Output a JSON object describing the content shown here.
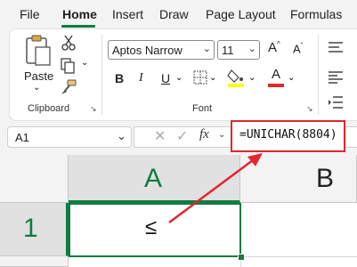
{
  "menu": {
    "tabs": [
      "File",
      "Home",
      "Insert",
      "Draw",
      "Page Layout",
      "Formulas"
    ],
    "active": "Home"
  },
  "ribbon": {
    "clipboard": {
      "paste_label": "Paste",
      "group_label": "Clipboard"
    },
    "font": {
      "font_name": "Aptos Narrow",
      "font_size": "11",
      "bold": "B",
      "italic": "I",
      "underline": "U",
      "grow": "A^",
      "shrink": "Aˇ",
      "group_label": "Font"
    },
    "colors": {
      "highlight": "#ffff00",
      "font_color": "#e1262f",
      "accent": "#107c41"
    }
  },
  "formula_bar": {
    "name_box": "A1",
    "fx": "fx",
    "formula": "=UNICHAR(8804)"
  },
  "sheet": {
    "columns": [
      "A",
      "B"
    ],
    "rows": [
      "1"
    ],
    "cells": {
      "A1": "≤"
    }
  },
  "annotation": {
    "arrow_color": "#e1262f"
  }
}
